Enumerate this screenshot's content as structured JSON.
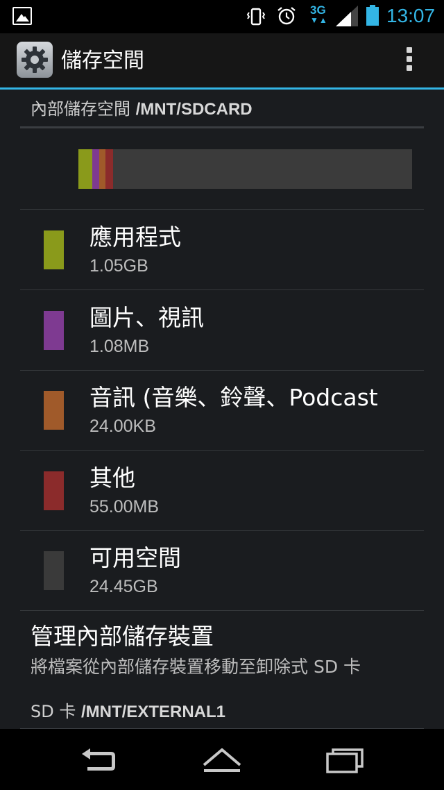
{
  "status_bar": {
    "time": "13:07",
    "network": "3G",
    "network_arrows": "▼▲",
    "accent": "#33b5e5"
  },
  "action_bar": {
    "title": "儲存空間",
    "icon": "settings-gear-icon",
    "overflow_icon": "overflow-menu-icon"
  },
  "internal": {
    "header_label": "內部儲存空間 ",
    "header_path": "/MNT/SDCARD",
    "usage_fractions": [
      {
        "color": "#8a9a1b",
        "fraction": 0.042
      },
      {
        "color": "#7e3a91",
        "fraction": 0.02
      },
      {
        "color": "#a05a2a",
        "fraction": 0.02
      },
      {
        "color": "#8b2b2b",
        "fraction": 0.022
      }
    ],
    "items": [
      {
        "title": "應用程式",
        "size": "1.05GB",
        "color": "#8a9a1b"
      },
      {
        "title": "圖片、視訊",
        "size": "1.08MB",
        "color": "#7e3a91"
      },
      {
        "title": "音訊 (音樂、鈴聲、Podcast",
        "size": "24.00KB",
        "color": "#a05a2a"
      },
      {
        "title": "其他",
        "size": "55.00MB",
        "color": "#8b2b2b"
      },
      {
        "title": "可用空間",
        "size": "24.45GB",
        "color": "#3a3a3a"
      }
    ]
  },
  "manage": {
    "title": "管理內部儲存裝置",
    "subtitle": "將檔案從內部儲存裝置移動至卸除式 SD 卡"
  },
  "sdcard": {
    "header_label": "SD 卡 ",
    "header_path": "/MNT/EXTERNAL1"
  },
  "nav_bar": {
    "back": "back-icon",
    "home": "home-icon",
    "recents": "recent-apps-icon"
  }
}
